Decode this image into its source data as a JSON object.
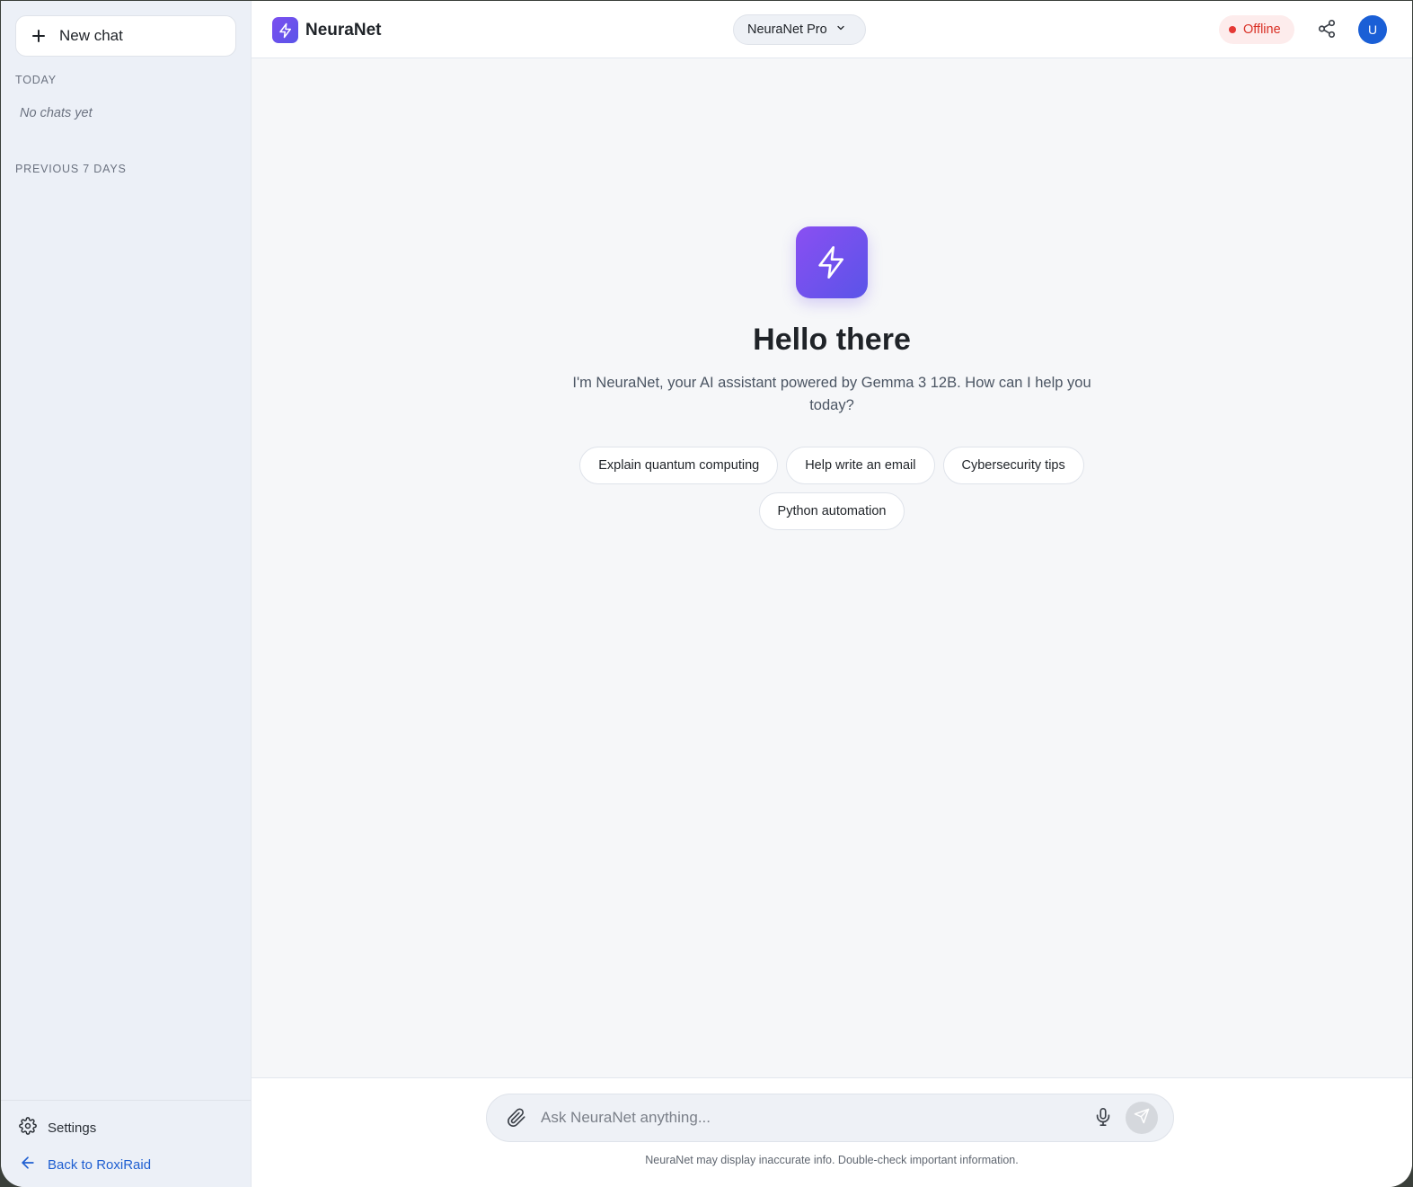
{
  "app": {
    "name": "NeuraNet"
  },
  "sidebar": {
    "new_chat_label": "New chat",
    "sections": [
      {
        "title": "TODAY",
        "empty_text": "No chats yet"
      },
      {
        "title": "PREVIOUS 7 DAYS"
      }
    ],
    "footer": {
      "settings_label": "Settings",
      "back_label": "Back to RoxiRaid"
    }
  },
  "header": {
    "model_selector": "NeuraNet Pro",
    "status": "Offline",
    "avatar_initial": "U"
  },
  "welcome": {
    "title": "Hello there",
    "subtitle": "I'm NeuraNet, your AI assistant powered by Gemma 3 12B. How can I help you today?",
    "suggestions": [
      "Explain quantum computing",
      "Help write an email",
      "Cybersecurity tips",
      "Python automation"
    ]
  },
  "composer": {
    "placeholder": "Ask NeuraNet anything...",
    "disclaimer": "NeuraNet may display inaccurate info. Double-check important information."
  },
  "colors": {
    "accent": "#6d51ee",
    "status_red": "#d93025",
    "link_blue": "#1f5fd1",
    "avatar_blue": "#1a5fd6"
  },
  "icons": {
    "brand": "lightning-bolt-icon",
    "attach": "paperclip-icon",
    "mic": "microphone-icon",
    "send": "send-icon",
    "share": "share-icon",
    "settings": "gear-icon",
    "back": "arrow-left-icon"
  }
}
